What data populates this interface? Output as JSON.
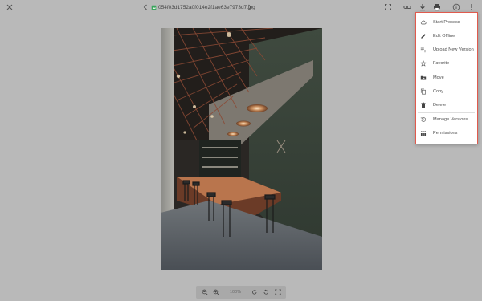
{
  "header": {
    "filename": "054f03d1752a0f014e2f1ae63e7973d7.jpg"
  },
  "icons": {
    "close": "close-icon",
    "prev": "chevron-left-icon",
    "next": "chevron-right-icon",
    "fullscreen": "fullscreen-icon",
    "link": "link-icon",
    "download": "download-icon",
    "print": "print-icon",
    "info": "info-icon",
    "more": "more-vertical-icon"
  },
  "menu": {
    "items": [
      {
        "label": "Start Process",
        "icon": "cloud-icon"
      },
      {
        "label": "Edit Offline",
        "icon": "pencil-icon"
      },
      {
        "label": "Upload New Version",
        "icon": "upload-version-icon"
      },
      {
        "label": "Favorite",
        "icon": "star-icon"
      },
      {
        "label": "Move",
        "icon": "folder-move-icon"
      },
      {
        "label": "Copy",
        "icon": "copy-icon"
      },
      {
        "label": "Delete",
        "icon": "trash-icon"
      },
      {
        "label": "Manage Versions",
        "icon": "history-icon"
      },
      {
        "label": "Permissions",
        "icon": "permissions-icon"
      }
    ]
  },
  "zoom": {
    "level": "100%"
  },
  "colors": {
    "menu_border": "#e05a4d",
    "backdrop": "#b9b9b9",
    "file_icon": "#3aa55c"
  }
}
